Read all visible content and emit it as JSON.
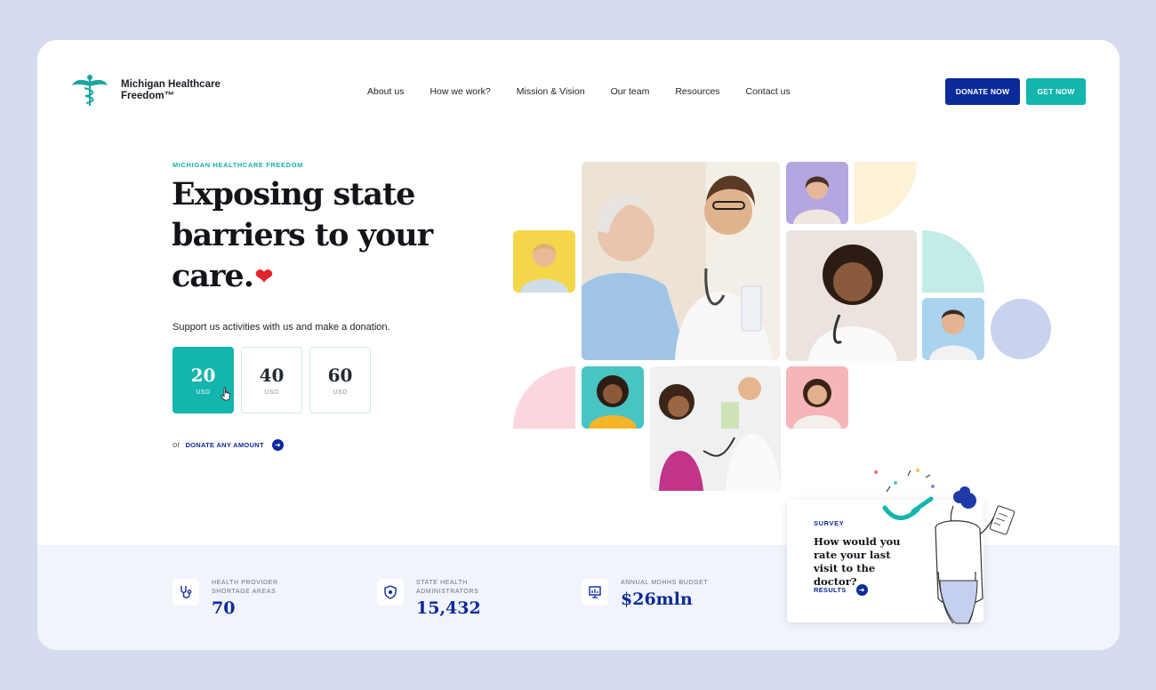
{
  "brand": {
    "name_line1": "Michigan Healthcare",
    "name_line2": "Freedom™",
    "icon": "caduceus-icon"
  },
  "nav": [
    "About us",
    "How we work?",
    "Mission & Vision",
    "Our team",
    "Resources",
    "Contact us"
  ],
  "actions": {
    "donate": "DONATE NOW",
    "get": "GET NOW"
  },
  "hero": {
    "eyebrow": "MICHIGAN HEALTHCARE FREEDOM",
    "title_line1": "Exposing state",
    "title_line2": "barriers to your",
    "title_line3": "care.",
    "heart": "❤",
    "support": "Support us activities with us and make a donation.",
    "amounts": [
      {
        "value": "20",
        "currency": "USD",
        "selected": true
      },
      {
        "value": "40",
        "currency": "USD",
        "selected": false
      },
      {
        "value": "60",
        "currency": "USD",
        "selected": false
      }
    ],
    "or": "or",
    "donate_any": "DONATE ANY AMOUNT"
  },
  "stats": [
    {
      "label": "HEALTH PROVIDER SHORTAGE AREAS",
      "value": "70",
      "icon": "stethoscope-icon"
    },
    {
      "label": "STATE HEALTH ADMINISTRATORS",
      "value": "15,432",
      "icon": "shield-icon"
    },
    {
      "label": "ANNUAL MDHHS BUDGET",
      "value": "$26mln",
      "icon": "presentation-icon"
    }
  ],
  "survey": {
    "tag": "SURVEY",
    "question": "How would you rate your last visit to the doctor?",
    "link": "RESULTS"
  },
  "colors": {
    "navy": "#0c2a9a",
    "teal": "#13b5ad",
    "page_bg": "#d5dcef"
  }
}
